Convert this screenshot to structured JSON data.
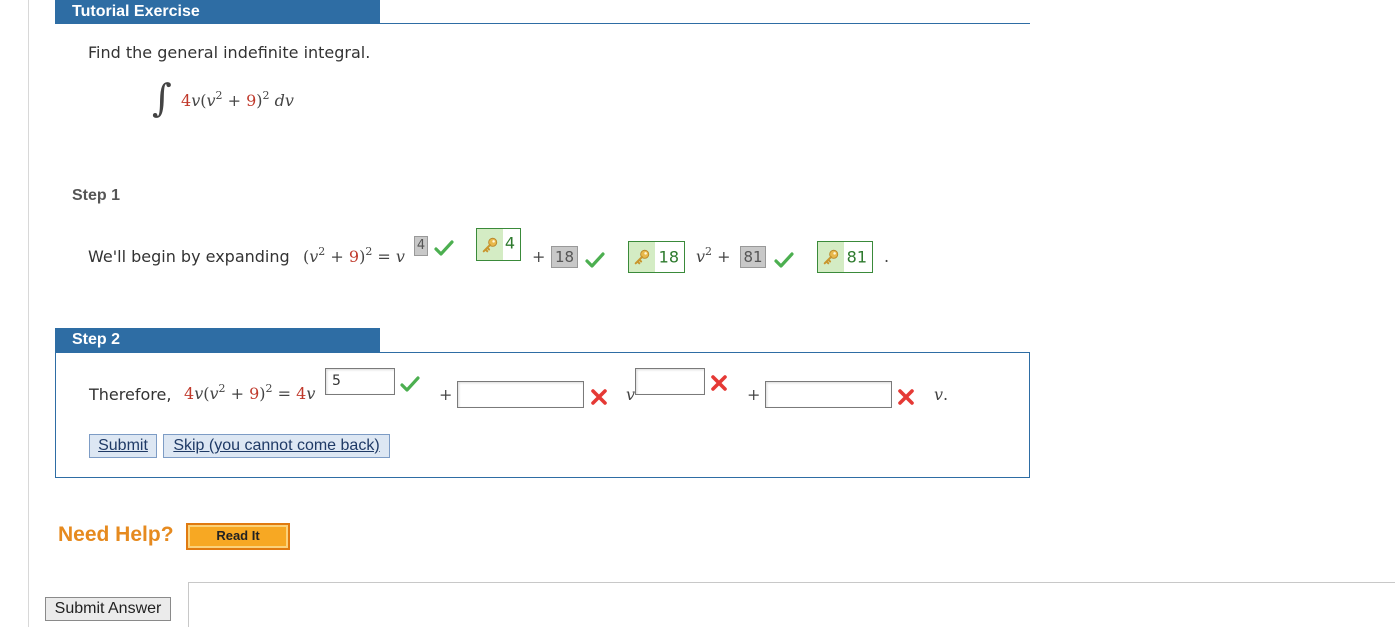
{
  "tutorial": {
    "header": "Tutorial Exercise",
    "prompt": "Find the general indefinite integral.",
    "integral_sign": "∫",
    "coef": "4",
    "var_v": "v",
    "open": "(",
    "v2_base": "v",
    "exp2": "2",
    "plus": " + ",
    "nine": "9",
    "close": ")",
    "dv": " dv"
  },
  "step1": {
    "label": "Step 1",
    "lead": "We'll begin by expanding",
    "paren_open": "(",
    "v": "v",
    "exp2": "2",
    "plus": " + ",
    "nine": "9",
    "paren_close": ")",
    "eq": " = ",
    "v_lead": "v",
    "exp_box": "4",
    "key1": "4",
    "plus1": "+",
    "box2": "18",
    "key2": "18",
    "v2": "v",
    "v2_exp": "2",
    "plus2": " + ",
    "box3": "81",
    "key3": "81",
    "period": "."
  },
  "step2": {
    "label": "Step 2",
    "lead": "Therefore,",
    "coef": "4",
    "v": "v",
    "paren_open": "(",
    "exp2": "2",
    "plus": " + ",
    "nine": "9",
    "paren_close": ")",
    "eq": " = ",
    "rhs_coef": "4",
    "rhs_v": "v",
    "exp_input": "5",
    "plus_a": "+",
    "input_a": "",
    "v_mid": "v",
    "exp_input_b": "",
    "plus_b": "+",
    "input_c": "",
    "v_end": "v",
    "end_period": ".",
    "submit_label": "Submit",
    "skip_label": "Skip (you cannot come back)"
  },
  "help": {
    "need_help": "Need Help?",
    "read_it": "Read It"
  },
  "footer": {
    "submit_answer": "Submit Answer"
  },
  "colors": {
    "header_blue": "#2e6da4",
    "math_red": "#c0392b",
    "check_green": "#4caf50",
    "cross_red": "#e53935",
    "help_orange": "#e68a1f"
  }
}
